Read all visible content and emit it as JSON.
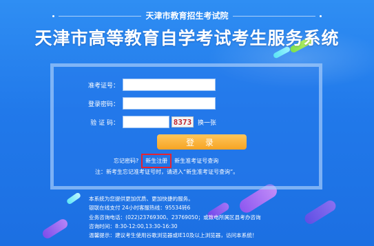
{
  "header": {
    "subtitle": "天津市教育招生考试院",
    "title": "天津市高等教育自学考试考生服务系统"
  },
  "login": {
    "exam_id_label": "准考证号：",
    "exam_id_value": "",
    "password_label": "登录密码：",
    "password_value": "",
    "captcha_label": "验  证  码：",
    "captcha_value": "",
    "captcha_image_text": "8373",
    "refresh_captcha": "换一张",
    "login_button": "登 录",
    "forgot_password": "忘记密码?",
    "new_register": "新生注册",
    "new_exam_id_query": "新生准考证号查询",
    "notice": "注：新考生忘记准考证号时，请进入“新生准考证号查询”。"
  },
  "info": {
    "line1": "本系统为您提供更加优质、更加快捷的服务。",
    "line2": "银联在线支付 24小时客服热线：95534转6",
    "line3": "业务咨询电话：(022)23769300、23769050；或致电所属区县考办咨询",
    "line4": "咨询时间：8:30-12:00,13:30-16:30",
    "line5": "温馨提示：建议考生使用谷歌浏览器或IE10及以上浏览器，访问本系统！"
  },
  "colors": {
    "background": "#2179ea",
    "login_button": "#f6a424",
    "highlight_box": "#e8232f",
    "captcha_text": "#c0262e"
  }
}
